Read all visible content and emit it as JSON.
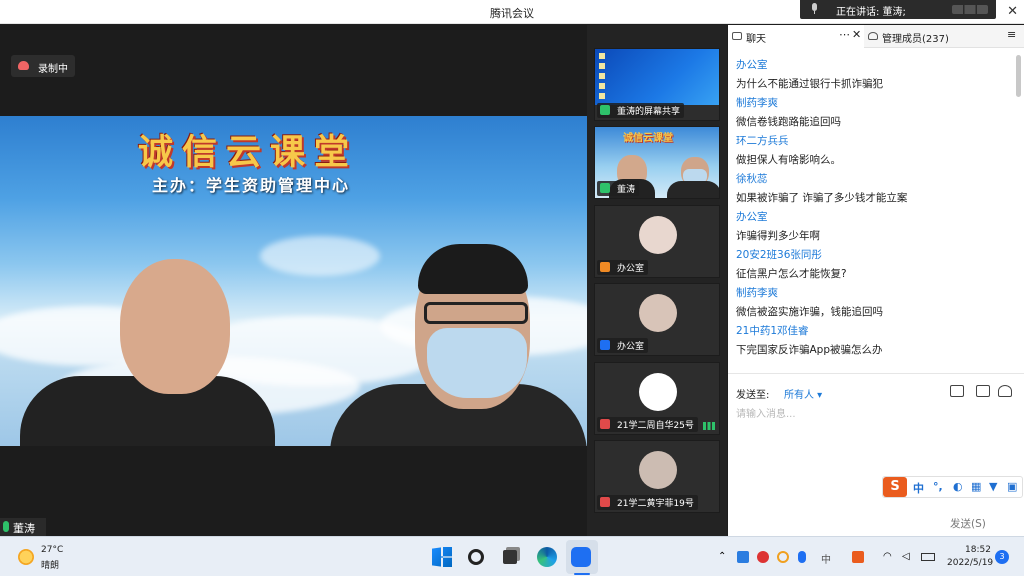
{
  "window": {
    "title": "腾讯会议"
  },
  "speaking": {
    "label": "正在讲话: 董涛;"
  },
  "recording": {
    "label": "录制中"
  },
  "stage": {
    "banner_title": "诚信云课堂",
    "banner_subtitle": "主办：学生资助管理中心",
    "speaker_name": "董涛"
  },
  "thumbnails": [
    {
      "label": "董涛的屏幕共享",
      "kind": "screen"
    },
    {
      "label": "董涛",
      "kind": "video"
    },
    {
      "label": "办公室",
      "kind": "avatar",
      "avatar_color": "#e8d7cf"
    },
    {
      "label": "办公室",
      "kind": "avatar",
      "avatar_color": "#d8c4b8"
    },
    {
      "label": "21学二周自华25号",
      "kind": "avatar",
      "avatar_color": "#ffffff"
    },
    {
      "label": "21学二黄宇菲19号",
      "kind": "avatar",
      "avatar_color": "#ccbcb2"
    }
  ],
  "chat": {
    "tab_chat": "聊天",
    "tab_members": "管理成员(237)",
    "messages": [
      {
        "sender": "办公室",
        "text": "为什么不能通过银行卡抓诈骗犯"
      },
      {
        "sender": "制药李爽",
        "text": "微信卷钱跑路能追回吗"
      },
      {
        "sender": "环二方兵兵",
        "text": "做担保人有啥影响么。"
      },
      {
        "sender": "徐秋蕊",
        "text": "如果被诈骗了 诈骗了多少钱才能立案"
      },
      {
        "sender": "办公室",
        "text": "诈骗得判多少年啊"
      },
      {
        "sender": "20安2班36张同彤",
        "text": "征信黑户怎么才能恢复?"
      },
      {
        "sender": "制药李爽",
        "text": "微信被盗实施诈骗，钱能追回吗"
      },
      {
        "sender": "21中药1邓佳睿",
        "text": "下完国家反诈骗App被骗怎么办"
      }
    ],
    "send_to_label": "发送至:",
    "recipient": "所有人",
    "input_placeholder": "请输入消息...",
    "send_button": "发送(S)"
  },
  "taskbar": {
    "temperature": "27°C",
    "condition": "晴朗",
    "time": "18:52",
    "date": "2022/5/19",
    "notifications": "3"
  },
  "colors": {
    "accent": "#1d7ad8",
    "brand": "#1e6ff2",
    "sender": "#1d7ad8"
  }
}
